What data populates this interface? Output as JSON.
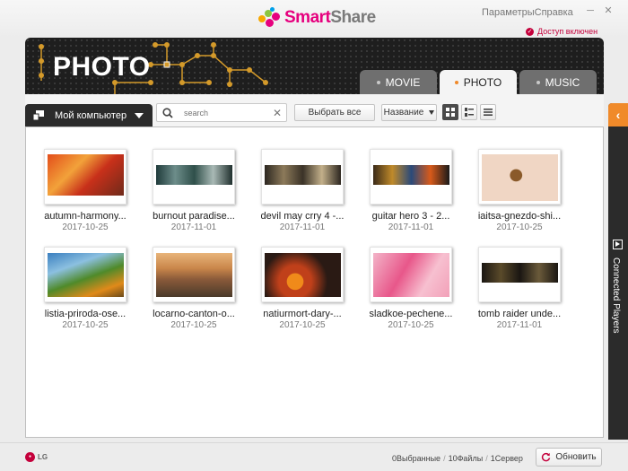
{
  "app": {
    "name_part1": "Smart",
    "name_part2": "Share"
  },
  "titlebar": {
    "links": "ПараметрыСправка",
    "access_label": "Доступ включен"
  },
  "banner": {
    "title": "PHOTO"
  },
  "tabs": [
    {
      "label": "MOVIE",
      "active": false
    },
    {
      "label": "PHOTO",
      "active": true
    },
    {
      "label": "MUSIC",
      "active": false
    }
  ],
  "toolbar": {
    "source_label": "Мой компьютер",
    "search_placeholder": "search",
    "select_all_label": "Выбрать все",
    "sort_label": "Название"
  },
  "items": [
    {
      "name": "autumn-harmony...",
      "date": "2017-10-25"
    },
    {
      "name": "burnout paradise...",
      "date": "2017-11-01"
    },
    {
      "name": "devil may crry 4 -...",
      "date": "2017-11-01"
    },
    {
      "name": "guitar hero 3 - 2...",
      "date": "2017-11-01"
    },
    {
      "name": "iaitsa-gnezdo-shi...",
      "date": "2017-10-25"
    },
    {
      "name": "listia-priroda-ose...",
      "date": "2017-10-25"
    },
    {
      "name": "locarno-canton-o...",
      "date": "2017-10-25"
    },
    {
      "name": "natiurmort-dary-...",
      "date": "2017-10-25"
    },
    {
      "name": "sladkoe-pechene...",
      "date": "2017-10-25"
    },
    {
      "name": "tomb raider unde...",
      "date": "2017-11-01"
    }
  ],
  "side_panel": {
    "label": "Connected Players"
  },
  "status": {
    "brand": "LG",
    "selected": "0Выбранные",
    "files": "10Файлы",
    "servers": "1Сервер",
    "refresh_label": "Обновить"
  },
  "colors": {
    "accent": "#f08a2a",
    "brand": "#e6007e",
    "alert": "#c4003b"
  }
}
